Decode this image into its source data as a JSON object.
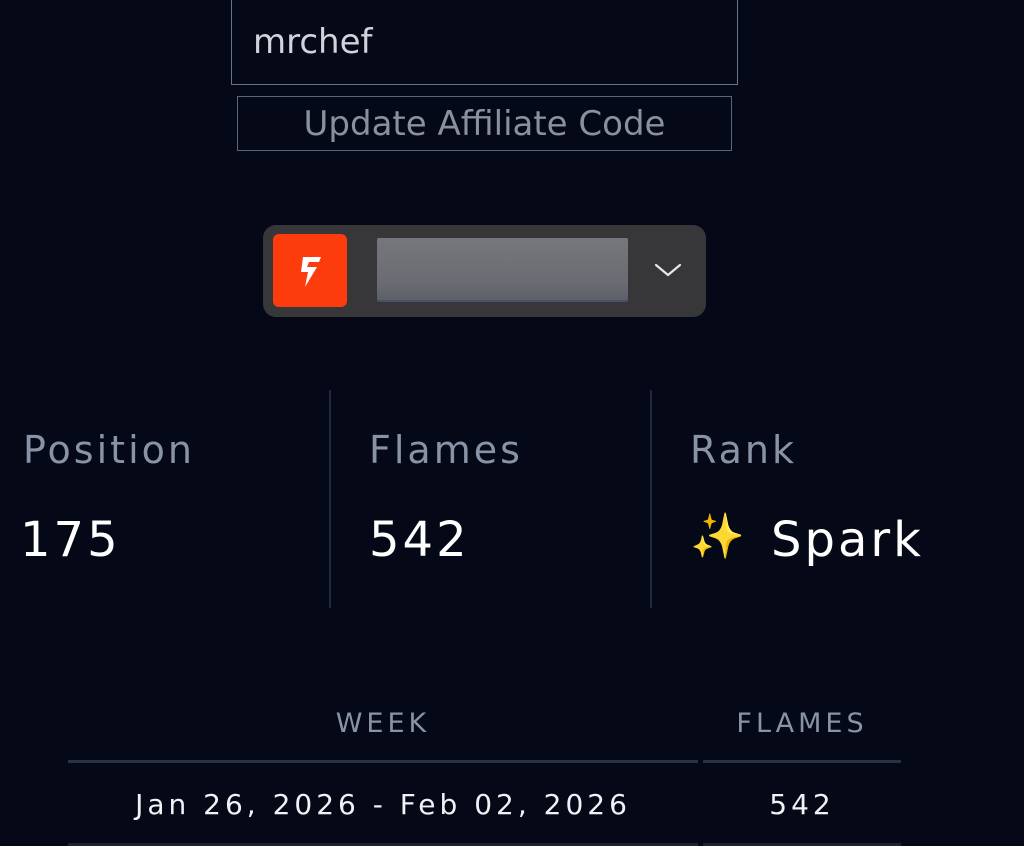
{
  "affiliate": {
    "code_value": "mrchef",
    "update_label": "Update Affiliate Code"
  },
  "selector": {
    "logo_icon": "flame-bolt-icon",
    "chevron_icon": "chevron-down-icon",
    "brand_color": "#fd3c0e"
  },
  "stats": {
    "position": {
      "label": "Position",
      "value": "175"
    },
    "flames": {
      "label": "Flames",
      "value": "542"
    },
    "rank": {
      "label": "Rank",
      "emoji": "✨",
      "value": "Spark"
    }
  },
  "table": {
    "headers": {
      "week": "WEEK",
      "flames": "FLAMES"
    },
    "rows": [
      {
        "week": "Jan 26, 2026 - Feb 02, 2026",
        "flames": "542"
      }
    ]
  }
}
